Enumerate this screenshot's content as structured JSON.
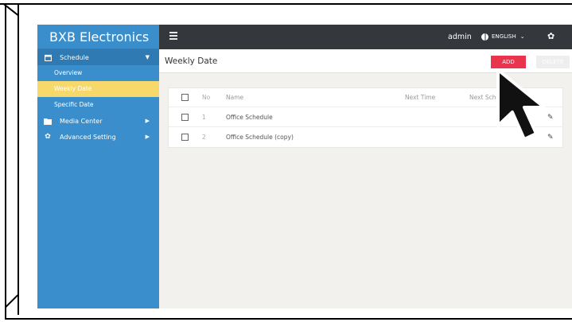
{
  "brand": "BXB Electronics",
  "topbar": {
    "user": "admin",
    "language": "ENGLISH",
    "icons": [
      "hamburger-icon",
      "globe-icon",
      "chevron-down-icon",
      "gear-icon"
    ]
  },
  "sidebar": {
    "items": [
      {
        "label": "Schedule",
        "icon": "calendar-icon",
        "expanded": true,
        "children": [
          {
            "label": "Overview",
            "active": false
          },
          {
            "label": "Weekly Date",
            "active": true
          },
          {
            "label": "Specific Date",
            "active": false
          }
        ]
      },
      {
        "label": "Media Center",
        "icon": "folder-icon",
        "expanded": false
      },
      {
        "label": "Advanced Setting",
        "icon": "gear-icon",
        "expanded": false
      }
    ]
  },
  "page": {
    "title": "Weekly Date",
    "add_label": "ADD",
    "delete_label": "DELETE"
  },
  "table": {
    "headers": {
      "no": "No",
      "name": "Name",
      "next_time": "Next Time",
      "next_schedule": "Next Sche"
    },
    "rows": [
      {
        "no": "1",
        "name": "Office Schedule"
      },
      {
        "no": "2",
        "name": "Office Schedule (copy)"
      }
    ]
  },
  "colors": {
    "sidebar": "#3a8ecb",
    "sidebar_active": "#f7d96b",
    "topbar": "#34383d",
    "add_button": "#e8344d"
  }
}
